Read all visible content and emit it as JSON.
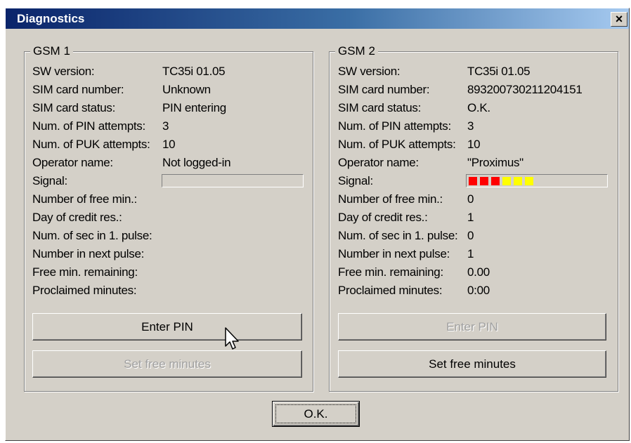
{
  "window": {
    "title": "Diagnostics",
    "close_glyph": "×"
  },
  "labels": {
    "sw_version": "SW version:",
    "sim_card_number": "SIM card number:",
    "sim_card_status": "SIM card status:",
    "pin_attempts": "Num. of PIN attempts:",
    "puk_attempts": "Num. of PUK attempts:",
    "operator_name": "Operator name:",
    "signal": "Signal:",
    "free_min": "Number of free min.:",
    "day_credit": "Day of credit res.:",
    "sec_first_pulse": "Num. of sec in 1. pulse:",
    "next_pulse": "Number in next pulse:",
    "free_min_remaining": "Free min. remaining:",
    "proclaimed_minutes": "Proclaimed minutes:"
  },
  "gsm1": {
    "title": "GSM 1",
    "values": {
      "sw_version": "TC35i 01.05",
      "sim_card_number": "Unknown",
      "sim_card_status": "PIN entering",
      "pin_attempts": "3",
      "puk_attempts": "10",
      "operator_name": "Not logged-in",
      "free_min": "",
      "day_credit": "",
      "sec_first_pulse": "",
      "next_pulse": "",
      "free_min_remaining": "",
      "proclaimed_minutes": ""
    },
    "signal_level": {
      "red": 0,
      "yellow": 0
    },
    "buttons": {
      "enter_pin": {
        "label": "Enter PIN",
        "enabled": true
      },
      "set_free_minutes": {
        "label": "Set free minutes",
        "enabled": false
      }
    }
  },
  "gsm2": {
    "title": "GSM 2",
    "values": {
      "sw_version": "TC35i 01.05",
      "sim_card_number": "893200730211204151",
      "sim_card_status": "O.K.",
      "pin_attempts": "3",
      "puk_attempts": "10",
      "operator_name": "\"Proximus\"",
      "free_min": "0",
      "day_credit": "1",
      "sec_first_pulse": "0",
      "next_pulse": "1",
      "free_min_remaining": "0.00",
      "proclaimed_minutes": "0:00"
    },
    "signal_level": {
      "red": 3,
      "yellow": 3
    },
    "buttons": {
      "enter_pin": {
        "label": "Enter PIN",
        "enabled": false
      },
      "set_free_minutes": {
        "label": "Set free minutes",
        "enabled": true
      }
    }
  },
  "ok_button": {
    "label": "O.K."
  },
  "colors": {
    "signal_red": "#ff0000",
    "signal_yellow": "#ffff00",
    "face": "#d4d0c8",
    "title_start": "#0a246a",
    "title_end": "#a6caf0"
  }
}
